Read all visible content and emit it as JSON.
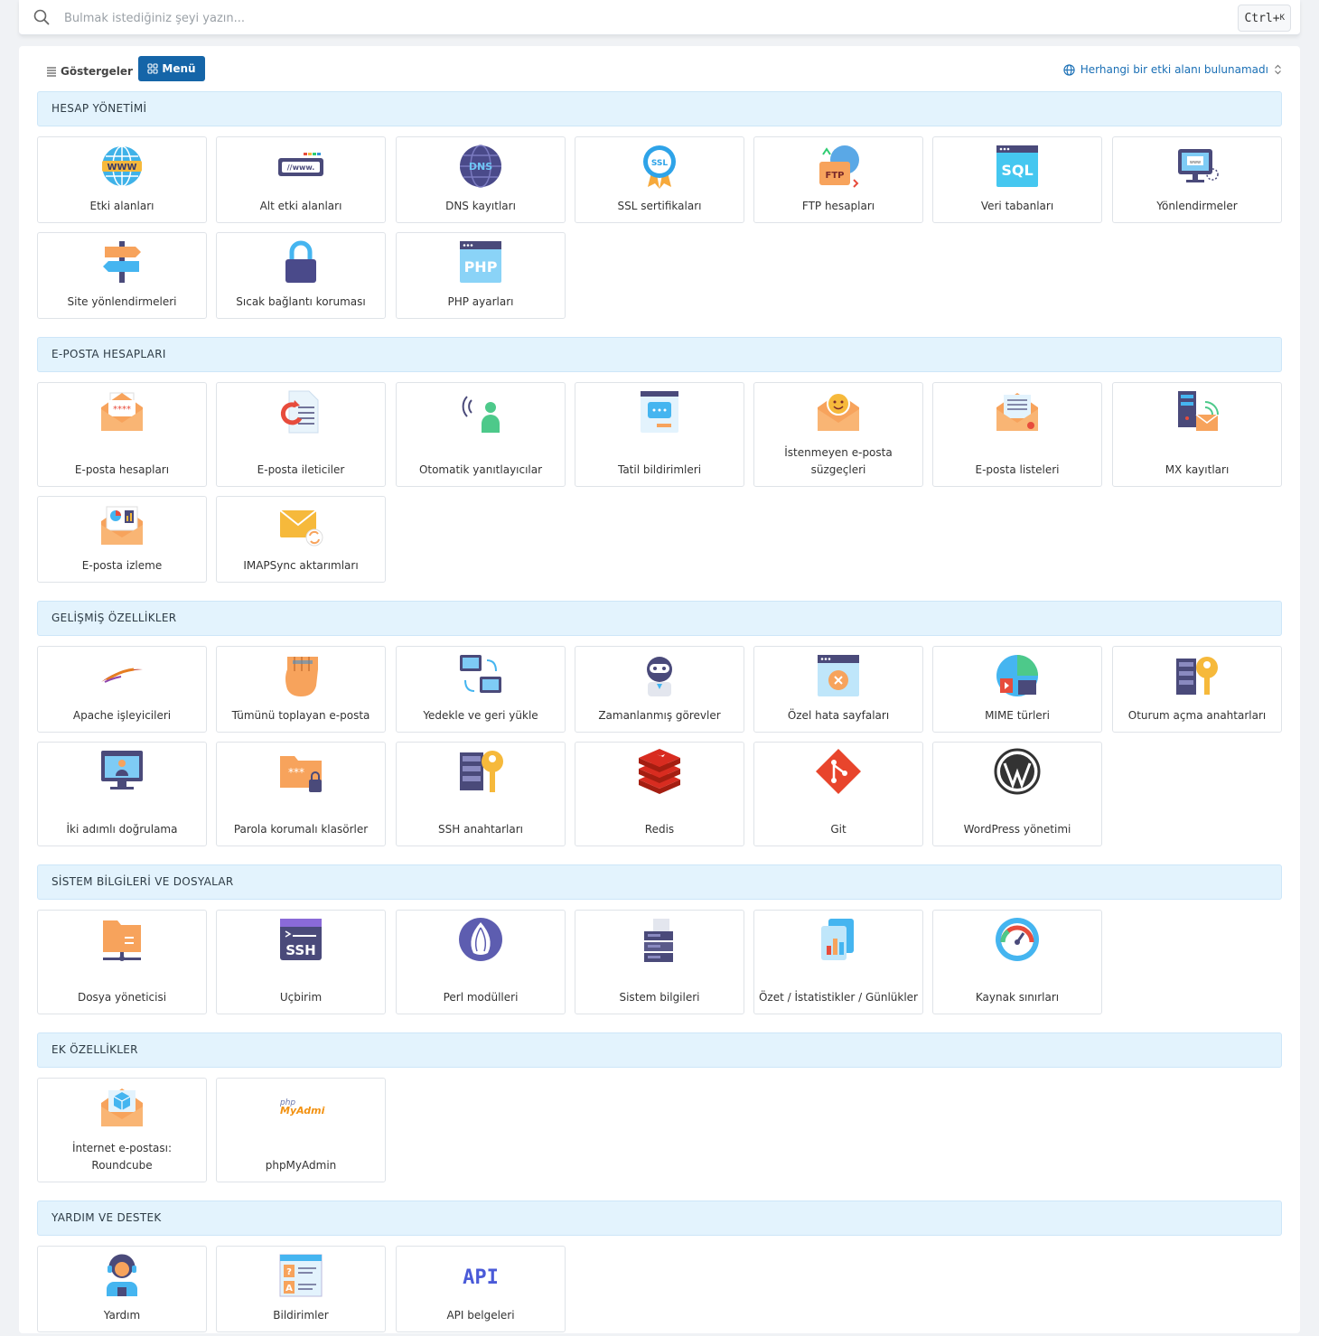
{
  "search": {
    "placeholder": "Bulmak istediğiniz şeyi yazın...",
    "shortcut": "Ctrl+",
    "shortcut_key": "K"
  },
  "toolbar": {
    "indicators_label": "Göstergeler",
    "menu_label": "Menü",
    "domain_label": "Herhangi bir etki alanı bulunamadı"
  },
  "colors": {
    "accent": "#1565a8",
    "section_bg": "#e3f3fd",
    "link": "#1a6fb5"
  },
  "sections": [
    {
      "title": "HESAP YÖNETİMİ",
      "items": [
        {
          "label": "Etki alanları",
          "icon": "globe-www-icon"
        },
        {
          "label": "Alt etki alanları",
          "icon": "subdomain-icon"
        },
        {
          "label": "DNS kayıtları",
          "icon": "dns-icon"
        },
        {
          "label": "SSL sertifikaları",
          "icon": "ssl-badge-icon"
        },
        {
          "label": "FTP hesapları",
          "icon": "ftp-folder-icon"
        },
        {
          "label": "Veri tabanları",
          "icon": "sql-database-icon"
        },
        {
          "label": "Yönlendirmeler",
          "icon": "redirect-monitor-icon"
        },
        {
          "label": "Site yönlendirmeleri",
          "icon": "signpost-icon"
        },
        {
          "label": "Sıcak bağlantı koruması",
          "icon": "padlock-icon"
        },
        {
          "label": "PHP ayarları",
          "icon": "php-window-icon"
        }
      ]
    },
    {
      "title": "E-POSTA HESAPLARI",
      "items": [
        {
          "label": "E-posta hesapları",
          "icon": "mail-password-icon"
        },
        {
          "label": "E-posta ileticiler",
          "icon": "mail-forward-icon"
        },
        {
          "label": "Otomatik yanıtlayıcılar",
          "icon": "autoresponder-icon"
        },
        {
          "label": "Tatil bildirimleri",
          "icon": "vacation-note-icon"
        },
        {
          "label": "İstenmeyen e-posta süzgeçleri",
          "icon": "spam-filter-icon"
        },
        {
          "label": "E-posta listeleri",
          "icon": "mailing-list-icon"
        },
        {
          "label": "MX kayıtları",
          "icon": "mx-server-icon"
        },
        {
          "label": "E-posta izleme",
          "icon": "mail-tracking-icon"
        },
        {
          "label": "IMAPSync aktarımları",
          "icon": "imapsync-icon"
        }
      ]
    },
    {
      "title": "GELİŞMİŞ ÖZELLİKLER",
      "items": [
        {
          "label": "Apache işleyicileri",
          "icon": "apache-feather-icon"
        },
        {
          "label": "Tümünü toplayan e-posta",
          "icon": "catch-all-glove-icon"
        },
        {
          "label": "Yedekle ve geri yükle",
          "icon": "backup-restore-icon"
        },
        {
          "label": "Zamanlanmış görevler",
          "icon": "robot-cron-icon"
        },
        {
          "label": "Özel hata sayfaları",
          "icon": "error-page-icon"
        },
        {
          "label": "MIME türleri",
          "icon": "mime-types-icon"
        },
        {
          "label": "Oturum açma anahtarları",
          "icon": "login-keys-icon"
        },
        {
          "label": "İki adımlı doğrulama",
          "icon": "two-factor-icon"
        },
        {
          "label": "Parola korumalı klasörler",
          "icon": "locked-folder-icon"
        },
        {
          "label": "SSH anahtarları",
          "icon": "ssh-keys-icon"
        },
        {
          "label": "Redis",
          "icon": "redis-icon"
        },
        {
          "label": "Git",
          "icon": "git-icon"
        },
        {
          "label": "WordPress yönetimi",
          "icon": "wordpress-icon"
        }
      ]
    },
    {
      "title": "SİSTEM BİLGİLERİ VE DOSYALAR",
      "items": [
        {
          "label": "Dosya yöneticisi",
          "icon": "file-manager-icon"
        },
        {
          "label": "Uçbirim",
          "icon": "ssh-terminal-icon"
        },
        {
          "label": "Perl modülleri",
          "icon": "perl-onion-icon"
        },
        {
          "label": "Sistem bilgileri",
          "icon": "system-info-icon"
        },
        {
          "label": "Özet / İstatistikler / Günlükler",
          "icon": "statistics-icon"
        },
        {
          "label": "Kaynak sınırları",
          "icon": "gauge-icon"
        }
      ]
    },
    {
      "title": "EK ÖZELLİKLER",
      "items": [
        {
          "label": "İnternet e-postası: Roundcube",
          "icon": "roundcube-icon"
        },
        {
          "label": "phpMyAdmin",
          "icon": "phpmyadmin-icon"
        }
      ]
    },
    {
      "title": "YARDIM VE DESTEK",
      "items": [
        {
          "label": "Yardım",
          "icon": "support-agent-icon"
        },
        {
          "label": "Bildirimler",
          "icon": "notifications-doc-icon"
        },
        {
          "label": "API belgeleri",
          "icon": "api-icon"
        }
      ]
    }
  ],
  "icon_text": {
    "www": "WWW",
    "dns": "DNS",
    "ssl": "SSL",
    "ftp": "FTP",
    "sql": "SQL",
    "php": "PHP",
    "ssh": "SSH",
    "api": "API",
    "pma_php": "php",
    "pma_name": "MyAdmin"
  }
}
